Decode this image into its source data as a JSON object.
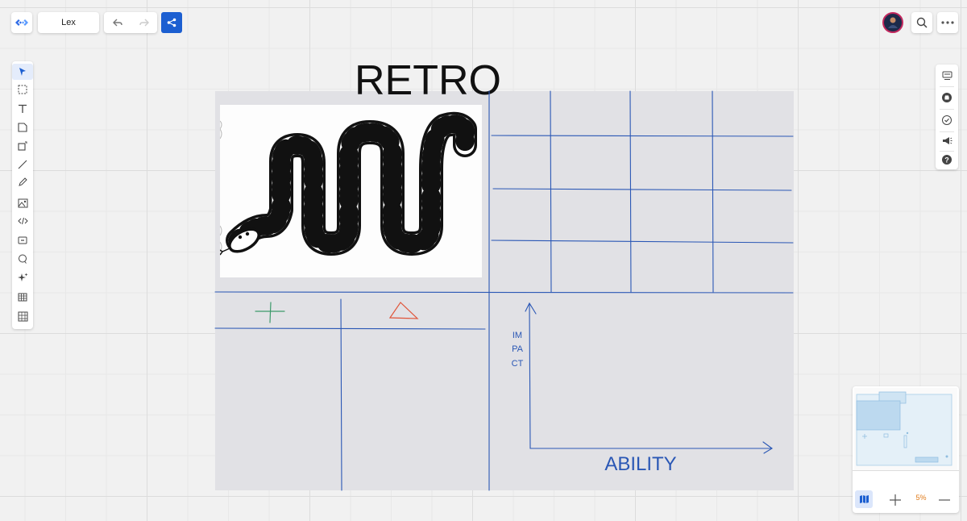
{
  "header": {
    "board_title": "Lex",
    "icons": [
      "logo-icon",
      "undo-icon",
      "redo-icon",
      "share-icon"
    ]
  },
  "toolbar": {
    "tools": [
      "select",
      "frame",
      "text",
      "sticky-note",
      "shape",
      "line",
      "pen",
      "image",
      "embed",
      "card",
      "comment",
      "ai-assist",
      "table",
      "grid"
    ],
    "active_tool": "select"
  },
  "right_toolbar": {
    "tools": [
      "present",
      "github",
      "tasks",
      "announce",
      "help"
    ]
  },
  "board": {
    "title": "RETRO",
    "y_axis_label": "IMPACT",
    "x_axis_label": "ABILITY",
    "ink_colors": {
      "plus": "#3c9a6a",
      "delta": "#e0553a",
      "grid": "#2a57b5"
    }
  },
  "minimap": {
    "zoom_label": "5%"
  },
  "colors": {
    "accent": "#1c5fd1",
    "ink_blue": "#2a57b5"
  }
}
